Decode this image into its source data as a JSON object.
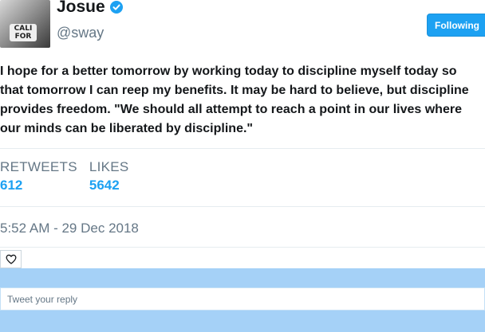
{
  "profile": {
    "name": "Josue",
    "handle": "@sway",
    "verified": true,
    "avatar_text": "CALI FOR"
  },
  "follow_button": {
    "label": "Following"
  },
  "tweet": {
    "text": "I hope for a better tomorrow by working today to discipline myself today so that tomorrow I can reep my benefits. It may be hard to believe, but discipline provides freedom. \"We should all attempt to reach a point in our lives where our minds can be liberated by discipline.\""
  },
  "stats": {
    "retweets_label": "RETWEETS",
    "retweets_value": "612",
    "likes_label": "LIKES",
    "likes_value": "5642"
  },
  "timestamp": "5:52 AM - 29 Dec 2018",
  "actions": {
    "like_icon": "heart-icon"
  },
  "reply": {
    "placeholder": "Tweet your reply"
  },
  "colors": {
    "accent": "#1da1f2",
    "muted_text": "#657786",
    "reply_background": "#a5d1f7"
  }
}
